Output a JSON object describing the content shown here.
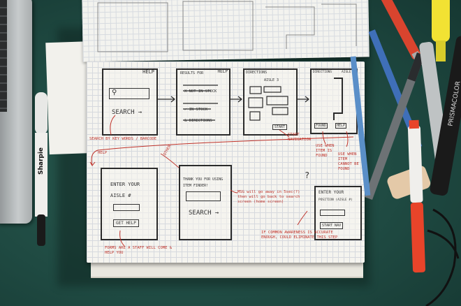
{
  "scene": {
    "description_free": true
  },
  "frames": {
    "f1": {
      "help": "HELP",
      "search": "SEARCH →"
    },
    "f2": {
      "results": "RESULTS FOR",
      "help": "HELP",
      "row1": "X  NOT IN STOCK",
      "row2": "✓  IN STOCK",
      "row3": "& DIRECTIONS"
    },
    "f3": {
      "directions": "DIRECTIONS",
      "aisle": "AISLE 3",
      "start": "START"
    },
    "f4": {
      "directions": "DIRECTIONS",
      "aisle": "AISLE 3",
      "found": "FOUND",
      "help": "HELP"
    },
    "f5": {
      "line1": "ENTER YOUR",
      "line2": "AISLE #",
      "button": "GET HELP"
    },
    "f6": {
      "line1": "THANK YOU FOR USING",
      "line2": "ITEM FINDER!",
      "search": "SEARCH →"
    },
    "f7": {
      "line1": "ENTER YOUR",
      "line2": "POSITION (AISLE #)",
      "button": "START NAV"
    }
  },
  "notes": {
    "n1": "SEARCH BY KEY WORDS / BARCODE",
    "n2": "START NAVIGATION",
    "n3": "USE WHEN ITEM IS FOUND",
    "n4": "USE WHEN ITEM CANNOT BE FOUND",
    "n5": "HELP",
    "n6": "OTHER",
    "n7": "MSG will go away in 5sec(?) then will go back to search screen (home screen)",
    "n8": "FORMS ARE A STAFF WILL COME & HELP YOU",
    "n9": "IF COMMON AWARENESS IS ACCURATE ENOUGH, COULD ELIMINATE THIS STEP",
    "n10": "?"
  },
  "props": {
    "sharpie": "Sharpie",
    "prismacolor": "PRISMACOLOR"
  },
  "colors": {
    "mat": "#1f4a42",
    "ink": "#2b2b2b",
    "red_ink": "#c0332b",
    "paper": "#f5f4ef"
  }
}
